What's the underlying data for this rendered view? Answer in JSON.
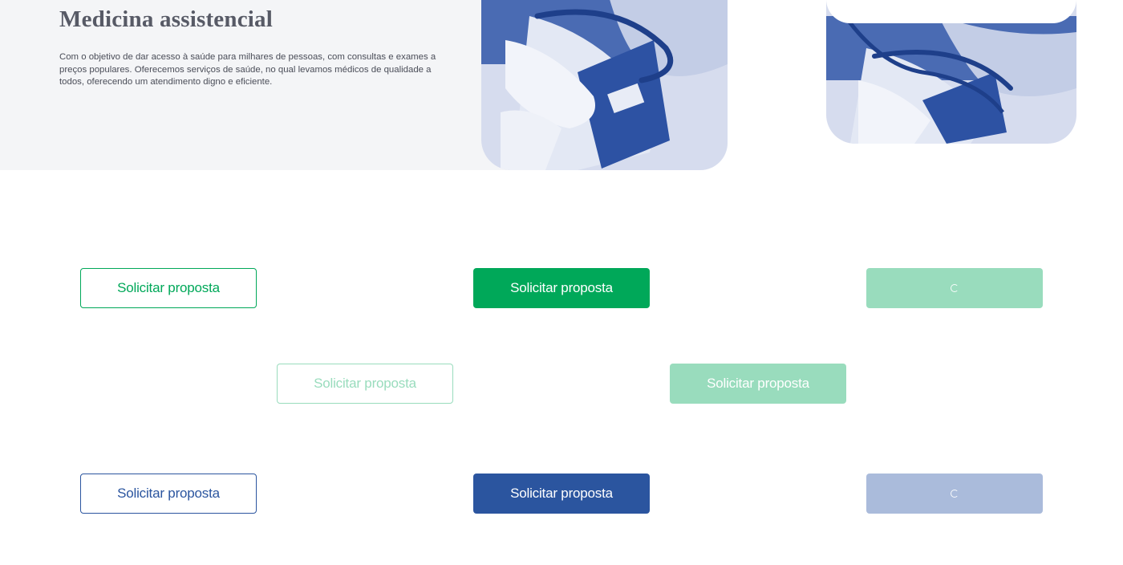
{
  "hero": {
    "title": "Medicina assistencial",
    "description": "Com o objetivo de dar acesso à saúde para milhares de pessoas, com consultas e exames a preços populares. Oferecemos serviços de saúde, no qual levamos médicos de qualidade a todos, oferecendo um atendimento digno e eficiente.",
    "image_icon": "doctor-blood-pressure-photo"
  },
  "side_card": {
    "image_icon": "doctor-blood-pressure-photo"
  },
  "buttons": {
    "green": {
      "outline_label": "Solicitar proposta",
      "solid_label": "Solicitar proposta",
      "loading_icon": "spinner-icon",
      "outline_disabled_label": "Solicitar proposta",
      "solid_disabled_label": "Solicitar proposta"
    },
    "blue": {
      "outline_label": "Solicitar proposta",
      "solid_label": "Solicitar proposta",
      "loading_icon": "spinner-icon"
    }
  },
  "colors": {
    "green": "#00a859",
    "green_light": "#99dcbd",
    "blue": "#2b559f",
    "blue_light": "#aabbdb",
    "title_gray": "#575a66",
    "hero_bg": "#f4f5f7"
  }
}
